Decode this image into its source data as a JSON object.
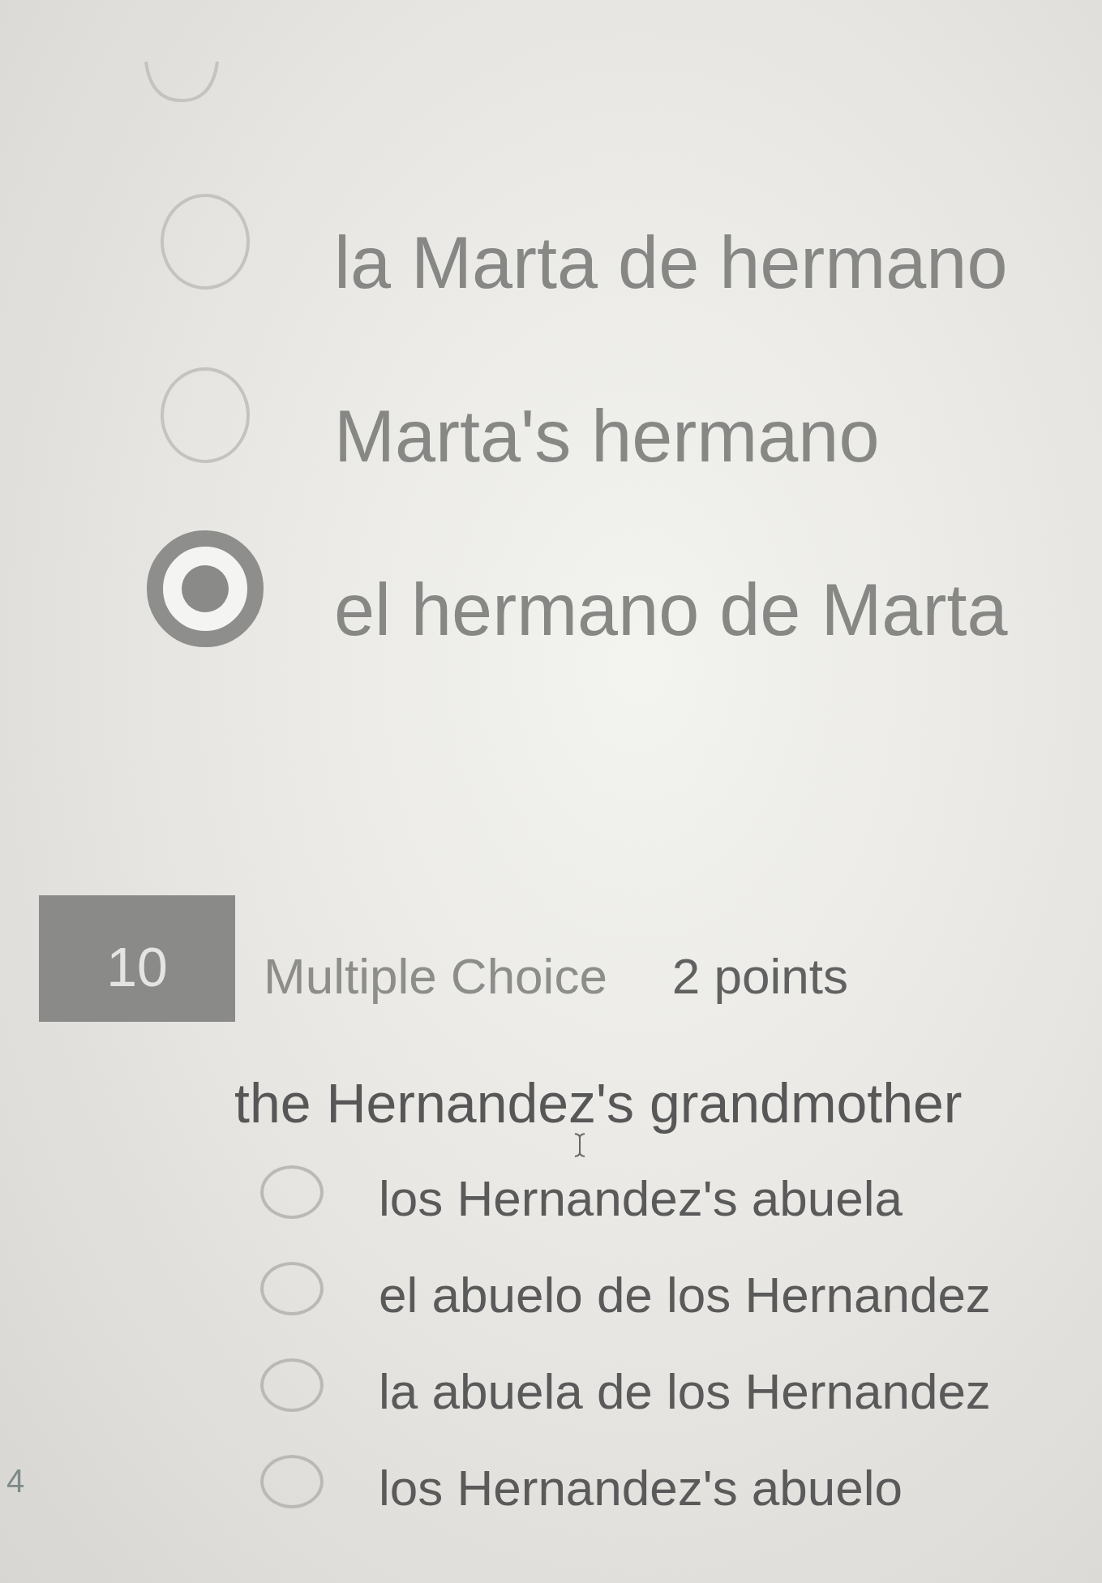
{
  "question_9": {
    "options": [
      {
        "label": "la Marta de hermano",
        "selected": false
      },
      {
        "label": "Marta's hermano",
        "selected": false
      },
      {
        "label": "el hermano de Marta",
        "selected": true
      }
    ]
  },
  "question_10": {
    "number": "10",
    "type": "Multiple Choice",
    "points": "2 points",
    "prompt": "the Hernandez's grandmother",
    "options": [
      {
        "label": "los Hernandez's abuela",
        "selected": false
      },
      {
        "label": "el abuelo de los Hernandez",
        "selected": false
      },
      {
        "label": "la abuela de los Hernandez",
        "selected": false
      },
      {
        "label": "los Hernandez's abuelo",
        "selected": false
      }
    ]
  },
  "page_marker": "4"
}
